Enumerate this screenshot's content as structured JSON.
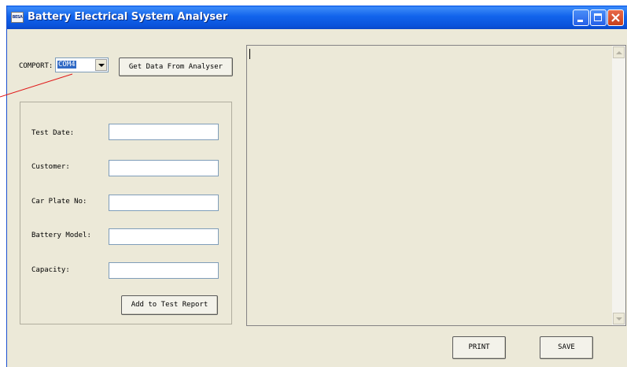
{
  "window": {
    "title": "Battery Electrical System Analyser",
    "icon_text": "BESA",
    "controls": [
      "minimize-icon",
      "maximize-icon",
      "close-icon"
    ]
  },
  "comport": {
    "label": "COMPORT:",
    "selected": "COM4"
  },
  "get_data_button": "Get Data From Analyser",
  "form": {
    "test_date": {
      "label": "Test Date:",
      "value": ""
    },
    "customer": {
      "label": "Customer:",
      "value": ""
    },
    "car_plate": {
      "label": "Car Plate No:",
      "value": ""
    },
    "battery_model": {
      "label": "Battery Model:",
      "value": ""
    },
    "capacity": {
      "label": "Capacity:",
      "value": ""
    },
    "add_button": "Add to Test Report"
  },
  "report_area": {
    "value": ""
  },
  "buttons": {
    "print": "PRINT",
    "save": "SAVE"
  },
  "colors": {
    "titlebar": "#0a53dc",
    "window_bg": "#ece9d8",
    "annotation_line": "#e01818"
  }
}
